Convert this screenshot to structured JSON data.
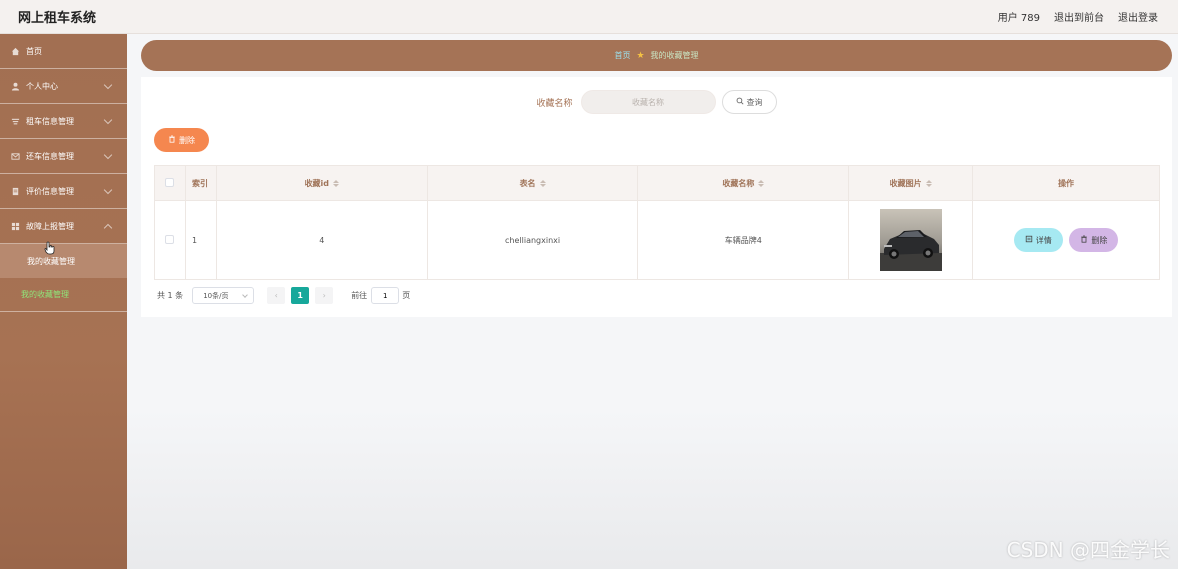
{
  "header": {
    "app_title": "网上租车系统",
    "user": "用户 789",
    "exit_front": "退出到前台",
    "logout": "退出登录"
  },
  "sidebar": {
    "items": [
      {
        "label": "首页",
        "icon": "home-icon"
      },
      {
        "label": "个人中心",
        "icon": "user-icon"
      },
      {
        "label": "租车信息管理",
        "icon": "list-icon"
      },
      {
        "label": "还车信息管理",
        "icon": "mail-icon"
      },
      {
        "label": "评价信息管理",
        "icon": "document-icon"
      },
      {
        "label": "故障上报管理",
        "icon": "grid-icon"
      }
    ],
    "sub_items": [
      {
        "label": "我的收藏管理"
      },
      {
        "label": "我的收藏管理"
      }
    ]
  },
  "breadcrumb": {
    "home": "首页",
    "current": "我的收藏管理"
  },
  "search": {
    "label": "收藏名称",
    "placeholder": "收藏名称",
    "button": "查询"
  },
  "toolbar": {
    "delete": "删除"
  },
  "table": {
    "headers": {
      "index": "索引",
      "fav_id": "收藏id",
      "table_name": "表名",
      "fav_name": "收藏名称",
      "fav_image": "收藏图片",
      "actions": "操作"
    },
    "rows": [
      {
        "index": "1",
        "fav_id": "4",
        "table_name": "chelliangxinxi",
        "fav_name": "车辆品牌4",
        "detail": "详情",
        "delete": "删除"
      }
    ]
  },
  "pager": {
    "total": "共 1 条",
    "page_size": "10条/页",
    "current_page": "1",
    "goto_prefix": "前往",
    "goto_value": "1",
    "goto_suffix": "页"
  },
  "watermark": "CSDN @四金学长",
  "colors": {
    "sidebar": "#a57356",
    "accent_orange": "#f5874f",
    "detail_btn": "#a6e9f2",
    "delete_btn": "#d3b6e6",
    "page_active": "#17a89b"
  }
}
